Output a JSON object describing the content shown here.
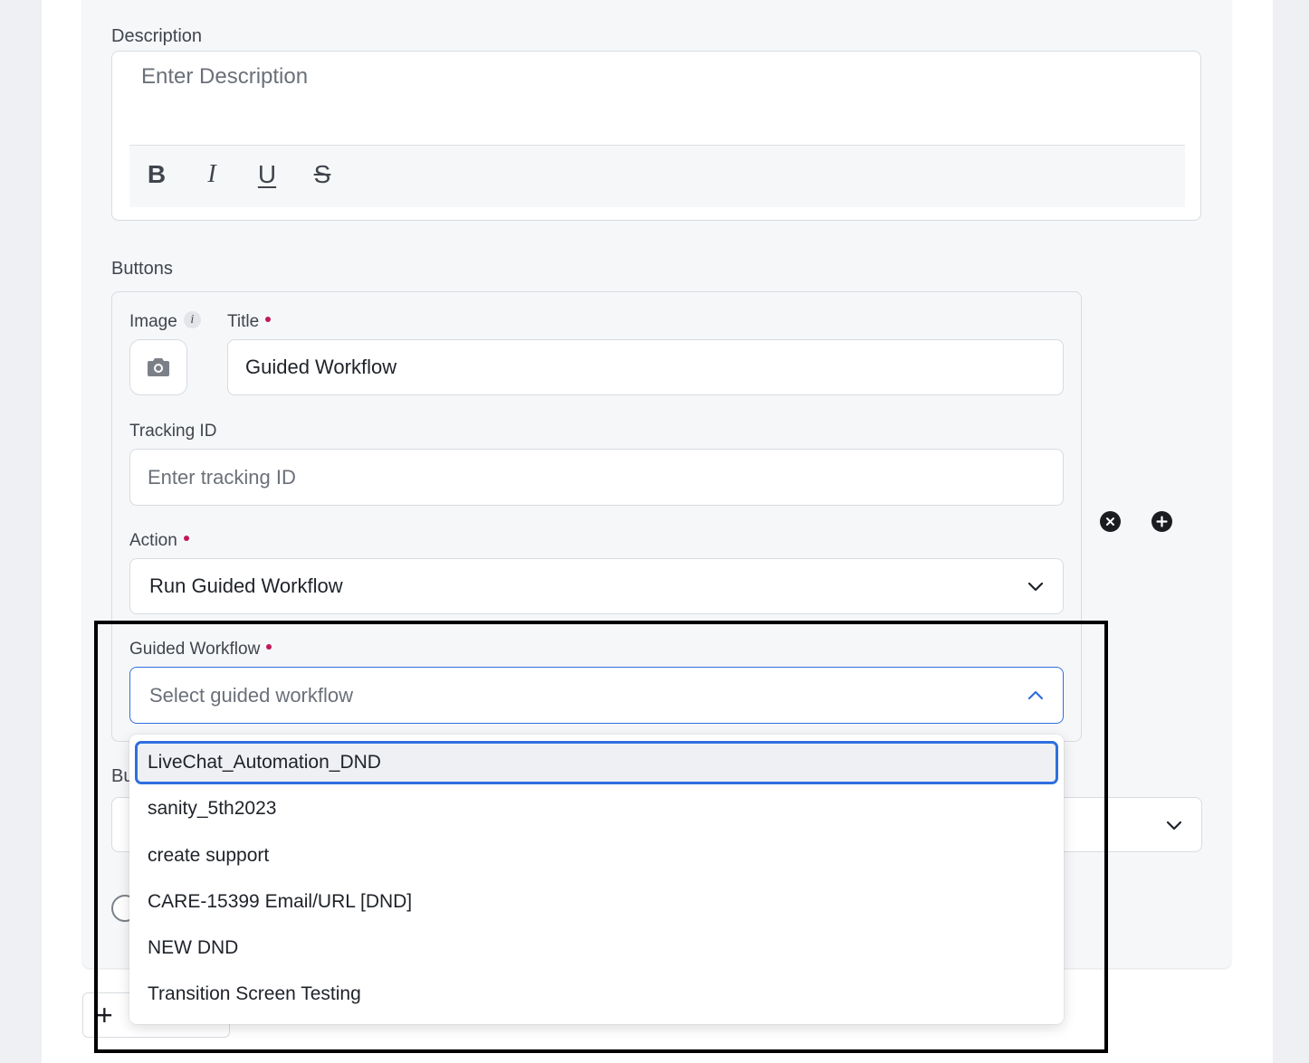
{
  "description": {
    "label": "Description",
    "placeholder": "Enter Description",
    "toolbar": {
      "bold_icon": "B",
      "italic_icon": "I",
      "underline_icon": "U",
      "strike_icon": "S"
    }
  },
  "buttons": {
    "section_label": "Buttons",
    "image_label": "Image",
    "info_icon": "i",
    "title_label": "Title",
    "title_value": "Guided Workflow",
    "tracking_label": "Tracking ID",
    "tracking_placeholder": "Enter tracking ID",
    "action_label": "Action",
    "action_value": "Run Guided Workflow",
    "guided_label": "Guided Workflow",
    "guided_placeholder": "Select guided workflow"
  },
  "dropdown": {
    "options": [
      "LiveChat_Automation_DND",
      "sanity_5th2023",
      "create support",
      "CARE-15399 Email/URL [DND]",
      "NEW DND",
      "Transition Screen Testing"
    ]
  },
  "partially_hidden": {
    "label_fragment": "Bu"
  },
  "colors": {
    "accent": "#2f6fdf",
    "required": "#c2185b",
    "card_bg": "#f6f7f9"
  }
}
